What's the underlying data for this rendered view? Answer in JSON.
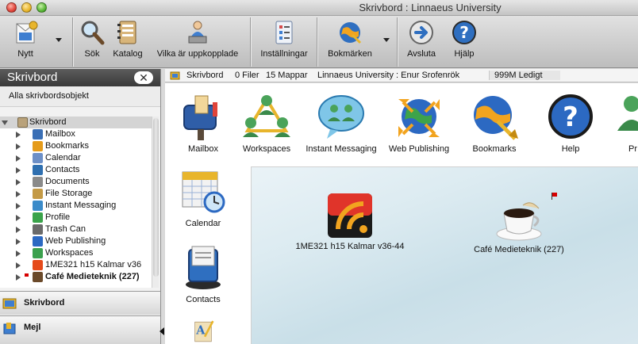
{
  "window": {
    "title": "Skrivbord : Linnaeus University"
  },
  "toolbar": {
    "new": "Nytt",
    "search": "Sök",
    "catalog": "Katalog",
    "who_online": "Vilka är uppkopplade",
    "settings": "Inställningar",
    "bookmarks": "Bokmärken",
    "quit": "Avsluta",
    "help": "Hjälp"
  },
  "sidebar": {
    "title": "Skrivbord",
    "close": "✕",
    "all_objects": "Alla skrivbordsobjekt",
    "root": "Skrivbord",
    "items": [
      {
        "label": "Mailbox",
        "icon": "mailbox-icon",
        "color": "#3a6fb5"
      },
      {
        "label": "Bookmarks",
        "icon": "bookmarks-icon",
        "color": "#e59b1a"
      },
      {
        "label": "Calendar",
        "icon": "calendar-icon",
        "color": "#6c8fc7"
      },
      {
        "label": "Contacts",
        "icon": "contacts-icon",
        "color": "#2e6fb0"
      },
      {
        "label": "Documents",
        "icon": "documents-icon",
        "color": "#8a8a8a"
      },
      {
        "label": "File Storage",
        "icon": "file-storage-icon",
        "color": "#c49a46"
      },
      {
        "label": "Instant Messaging",
        "icon": "instant-messaging-icon",
        "color": "#3b8bc9"
      },
      {
        "label": "Profile",
        "icon": "profile-icon",
        "color": "#3aa34a"
      },
      {
        "label": "Trash Can",
        "icon": "trash-can-icon",
        "color": "#6a6a6a"
      },
      {
        "label": "Web Publishing",
        "icon": "web-publishing-icon",
        "color": "#2c69c2"
      },
      {
        "label": "Workspaces",
        "icon": "workspaces-icon",
        "color": "#3ba04d"
      },
      {
        "label": "1ME321 h15 Kalmar v36",
        "icon": "rss-icon",
        "color": "#e54a1a"
      },
      {
        "label": "Café Medieteknik (227)",
        "icon": "coffee-icon",
        "color": "#6b4a2a"
      }
    ],
    "sections": {
      "desktop": "Skrivbord",
      "mail": "Mejl"
    }
  },
  "status": {
    "location": "Skrivbord",
    "files": "0 Filer",
    "folders": "15 Mappar",
    "user": "Linnaeus University : Enur Srofenrök",
    "free": "999M Ledigt"
  },
  "dock": {
    "mailbox": "Mailbox",
    "workspaces": "Workspaces",
    "instant_messaging": "Instant Messaging",
    "web_publishing": "Web Publishing",
    "bookmarks": "Bookmarks",
    "help": "Help",
    "partial": "Pr",
    "calendar": "Calendar",
    "contacts": "Contacts"
  },
  "desktop": {
    "conference": "1ME321 h15 Kalmar v36-44",
    "cafe": "Café Medieteknik (227)"
  },
  "colors": {
    "accent": "#2f6fc0",
    "flag": "#d60000",
    "sidebar_header": "#4a4a4a"
  }
}
